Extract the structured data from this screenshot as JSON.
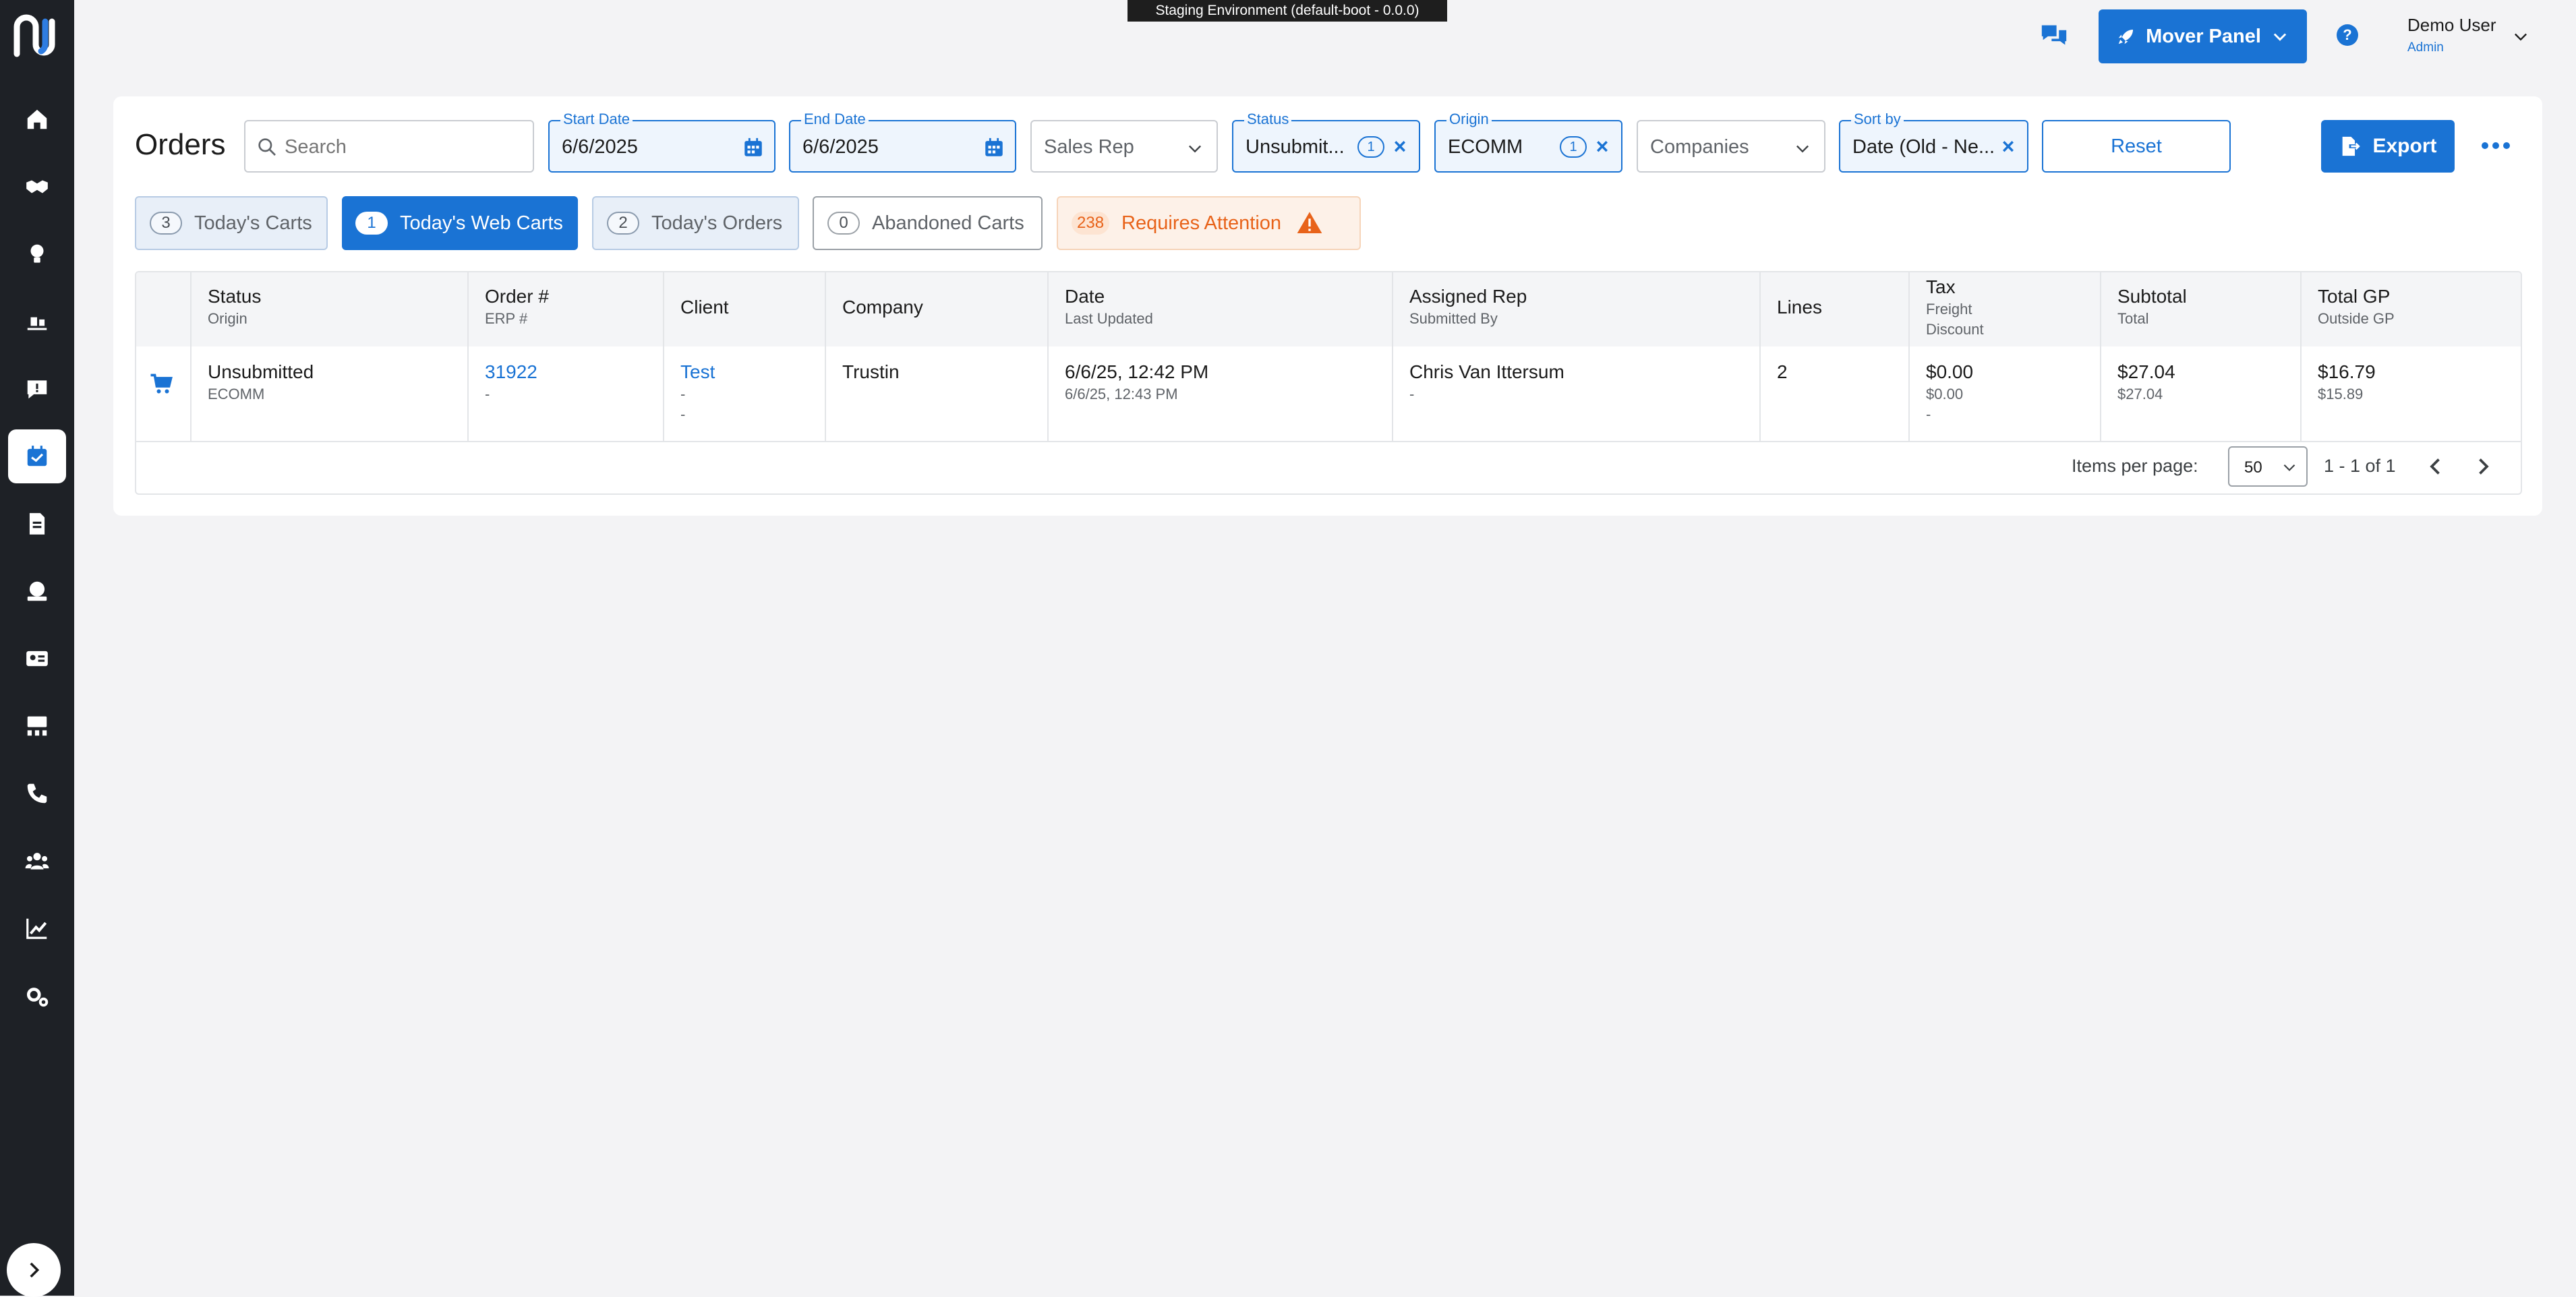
{
  "environment_banner": "Staging Environment (default-boot - 0.0.0)",
  "header": {
    "mover_panel_label": "Mover Panel",
    "help_label": "?",
    "user_name": "Demo User",
    "user_role": "Admin"
  },
  "sidebar": {
    "items": [
      {
        "icon": "home-icon"
      },
      {
        "icon": "handshake-icon"
      },
      {
        "icon": "lightbulb-icon"
      },
      {
        "icon": "forklift-icon"
      },
      {
        "icon": "alert-message-icon"
      },
      {
        "icon": "calendar-check-icon",
        "active": true
      },
      {
        "icon": "invoice-icon"
      },
      {
        "icon": "money-icon"
      },
      {
        "icon": "id-card-icon"
      },
      {
        "icon": "org-chart-icon"
      },
      {
        "icon": "phone-icon"
      },
      {
        "icon": "users-icon"
      },
      {
        "icon": "chart-line-icon"
      },
      {
        "icon": "settings-icon"
      }
    ]
  },
  "page": {
    "title": "Orders",
    "search_placeholder": "Search"
  },
  "filters": {
    "start_date": {
      "label": "Start Date",
      "value": "6/6/2025"
    },
    "end_date": {
      "label": "End Date",
      "value": "6/6/2025"
    },
    "sales_rep": {
      "placeholder": "Sales Rep"
    },
    "status": {
      "label": "Status",
      "value": "Unsubmit...",
      "count": "1"
    },
    "origin": {
      "label": "Origin",
      "value": "ECOMM",
      "count": "1"
    },
    "companies": {
      "placeholder": "Companies"
    },
    "sort_by": {
      "label": "Sort by",
      "value": "Date (Old - Ne..."
    },
    "reset_label": "Reset",
    "export_label": "Export"
  },
  "quick_filters": [
    {
      "count": "3",
      "label": "Today's Carts",
      "style": "light"
    },
    {
      "count": "1",
      "label": "Today's Web Carts",
      "style": "dark"
    },
    {
      "count": "2",
      "label": "Today's Orders",
      "style": "light"
    },
    {
      "count": "0",
      "label": "Abandoned Carts",
      "style": "outline"
    },
    {
      "count": "238",
      "label": "Requires Attention",
      "style": "warn"
    }
  ],
  "table": {
    "columns": [
      {
        "h1": "Status",
        "h2": "Origin"
      },
      {
        "h1": "Order #",
        "h2": "ERP #"
      },
      {
        "h1": "Client",
        "h2": ""
      },
      {
        "h1": "Company",
        "h2": ""
      },
      {
        "h1": "Date",
        "h2": "Last Updated"
      },
      {
        "h1": "Assigned Rep",
        "h2": "Submitted By"
      },
      {
        "h1": "Lines",
        "h2": ""
      },
      {
        "h1": "Tax",
        "h2": "Freight",
        "h3": "Discount"
      },
      {
        "h1": "Subtotal",
        "h2": "Total"
      },
      {
        "h1": "Total GP",
        "h2": "Outside GP"
      }
    ],
    "rows": [
      {
        "status": "Unsubmitted",
        "origin": "ECOMM",
        "order_no": "31922",
        "erp_no": "-",
        "client": "Test",
        "client_sub1": "-",
        "client_sub2": "-",
        "company": "Trustin",
        "date": "6/6/25, 12:42 PM",
        "last_updated": "6/6/25, 12:43 PM",
        "assigned_rep": "Chris Van Ittersum",
        "submitted_by": "-",
        "lines": "2",
        "tax": "$0.00",
        "freight": "$0.00",
        "discount": "-",
        "subtotal": "$27.04",
        "total": "$27.04",
        "total_gp": "$16.79",
        "outside_gp": "$15.89"
      }
    ]
  },
  "pagination": {
    "items_per_page_label": "Items per page:",
    "items_per_page": "50",
    "range": "1 - 1 of 1"
  },
  "colors": {
    "accent": "#1a73d4",
    "sidebar": "#1e2126",
    "warning": "#e8631a"
  }
}
